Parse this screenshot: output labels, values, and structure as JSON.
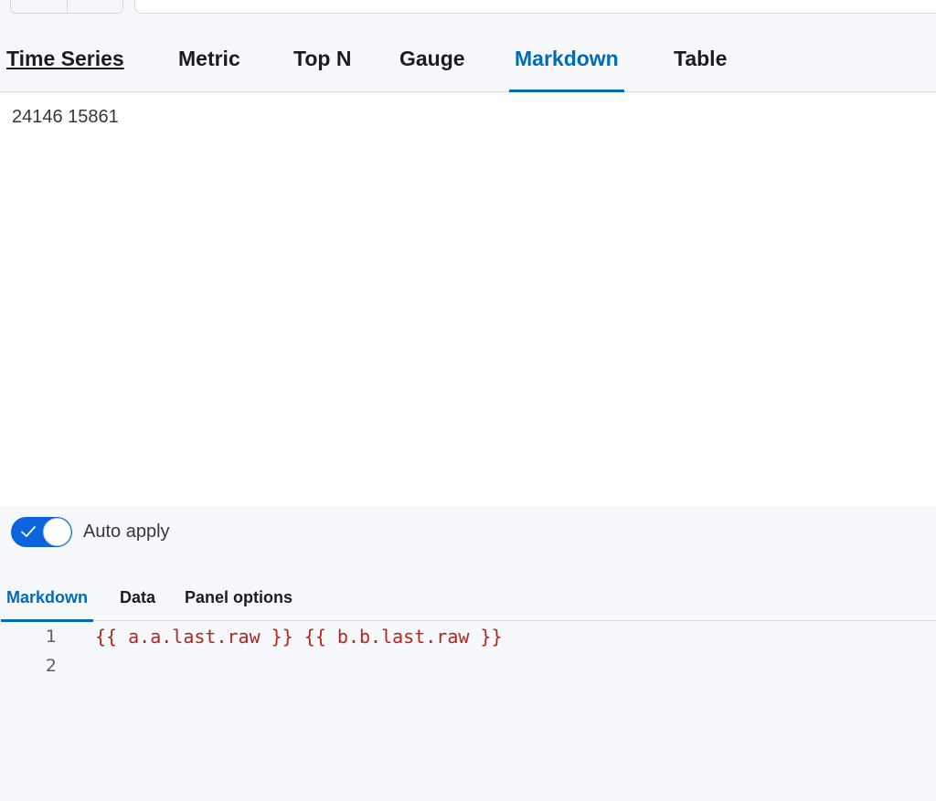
{
  "viz_tabs": [
    {
      "label": "Time Series"
    },
    {
      "label": "Metric"
    },
    {
      "label": "Top N"
    },
    {
      "label": "Gauge"
    },
    {
      "label": "Markdown"
    },
    {
      "label": "Table"
    }
  ],
  "active_viz_tab": "Markdown",
  "preview": {
    "text": "24146 15861"
  },
  "auto_apply": {
    "label": "Auto apply",
    "enabled": true
  },
  "editor_tabs": [
    {
      "label": "Markdown"
    },
    {
      "label": "Data"
    },
    {
      "label": "Panel options"
    }
  ],
  "active_editor_tab": "Markdown",
  "editor": {
    "lines": [
      {
        "number": "1",
        "code": "{{ a.a.last.raw }} {{ b.b.last.raw }}"
      },
      {
        "number": "2",
        "code": ""
      }
    ]
  },
  "colors": {
    "accent": "#006bb8",
    "code_text": "#b4251d",
    "toggle_on": "#0b64dd"
  },
  "icons": {
    "toggle_check": "check-icon"
  }
}
